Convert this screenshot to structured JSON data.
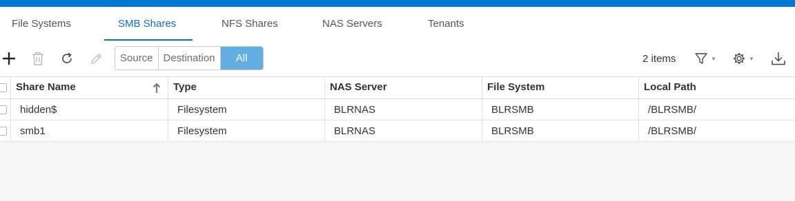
{
  "tabs": [
    {
      "label": "File Systems",
      "active": false
    },
    {
      "label": "SMB Shares",
      "active": true
    },
    {
      "label": "NFS Shares",
      "active": false
    },
    {
      "label": "NAS Servers",
      "active": false
    },
    {
      "label": "Tenants",
      "active": false
    }
  ],
  "toolbar": {
    "add_icon": "plus-icon",
    "delete_icon": "trash-icon",
    "refresh_icon": "refresh-icon",
    "edit_icon": "pencil-icon",
    "segments": [
      "Source",
      "Destination",
      "All"
    ],
    "selected_segment": "All",
    "items_count": "2 items",
    "filter_icon": "filter-icon",
    "settings_icon": "gear-icon",
    "download_icon": "download-icon"
  },
  "table": {
    "columns": [
      "Share Name",
      "Type",
      "NAS Server",
      "File System",
      "Local Path"
    ],
    "sort_column": "Share Name",
    "sort_direction": "ascending",
    "rows": [
      [
        "hidden$",
        "Filesystem",
        "BLRNAS",
        "BLRSMB",
        "/BLRSMB/"
      ],
      [
        "smb1",
        "Filesystem",
        "BLRNAS",
        "BLRSMB",
        "/BLRSMB/"
      ]
    ]
  },
  "colors": {
    "brand_bar": "#0076ce",
    "active_tab": "#0a6ed1",
    "selected_segment": "#62aee3"
  }
}
